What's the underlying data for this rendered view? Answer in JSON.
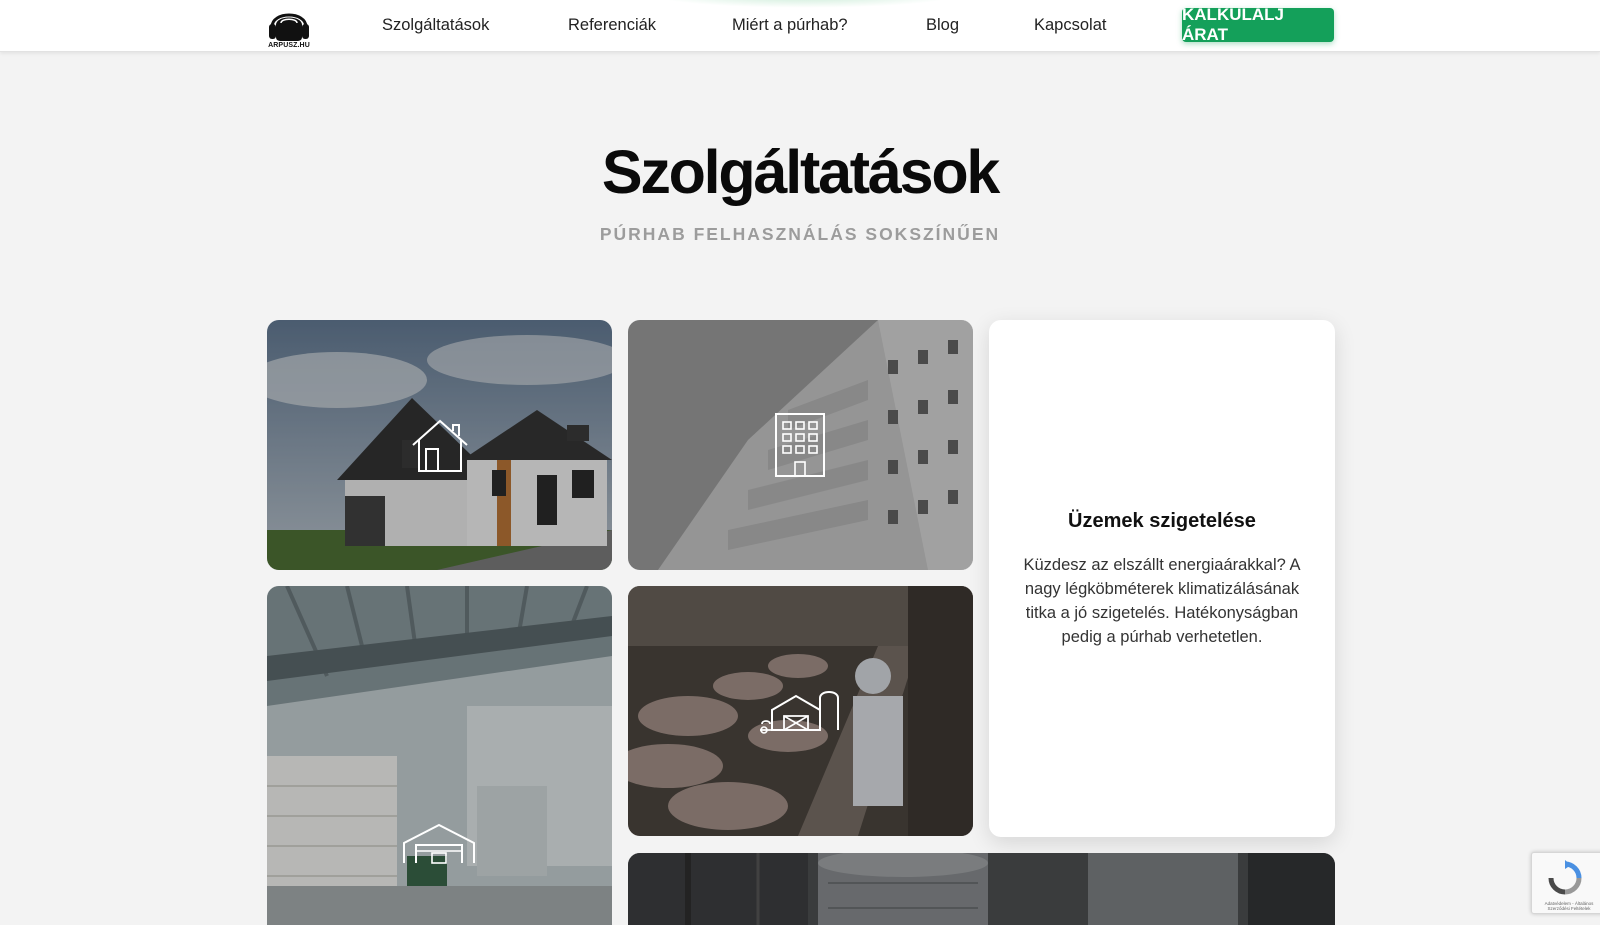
{
  "header": {
    "logo_text": "ARPUSZ.HU",
    "nav": [
      {
        "label": "Szolgáltatások"
      },
      {
        "label": "Referenciák"
      },
      {
        "label": "Miért a púrhab?"
      },
      {
        "label": "Blog"
      },
      {
        "label": "Kapcsolat"
      }
    ],
    "cta_label": "KALKULÁLJ ÁRAT"
  },
  "main": {
    "title": "Szolgáltatások",
    "subtitle": "PÚRHAB FELHASZNÁLÁS SOKSZÍNŰEN"
  },
  "tiles": [
    {
      "photo": "family-house",
      "icon": "house-icon"
    },
    {
      "photo": "apartment-block",
      "icon": "building-icon"
    },
    {
      "photo": "industrial-hall",
      "icon": "warehouse-icon"
    },
    {
      "photo": "pig-farm",
      "icon": "barn-icon"
    },
    {
      "photo": "industrial-tanks",
      "icon": "none"
    }
  ],
  "featured_card": {
    "title": "Üzemek szigetelése",
    "text": "Küzdesz az elszállt energiaárakkal? A nagy légköbméterek klimatizálásának titka a jó szigetelés. Hatékonyságban pedig a púrhab verhetetlen."
  },
  "colors": {
    "accent": "#14a05a",
    "page_background": "#f3f3f3",
    "title": "#0a0a0a",
    "subtitle": "#9c9c9c"
  },
  "recaptcha": {
    "text": "Adatvédelem - Általános Szerződési Feltételek"
  }
}
